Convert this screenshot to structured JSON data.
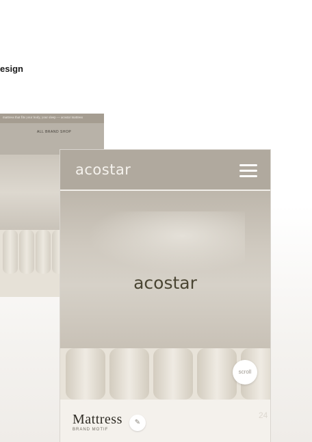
{
  "section": {
    "headline": "esign"
  },
  "back_screen": {
    "topbar_text": "mattress that fits your body, your sleep — acostar mattress",
    "nav_text": "ALL   BRAND   SHOP"
  },
  "front_screen": {
    "logo": "acostar",
    "brand_overlay": "acostar",
    "scroll_button_label": "scroll",
    "product_title": "Mattress",
    "product_subtitle": "BRAND MOTIF",
    "edit_icon_glyph": "✎"
  },
  "page_number": "24",
  "colors": {
    "header_bg": "#b0a99e",
    "brand_text": "#4a4533",
    "footer_bg": "#f4f1ec"
  },
  "icons": [
    "menu-icon",
    "edit-icon"
  ]
}
